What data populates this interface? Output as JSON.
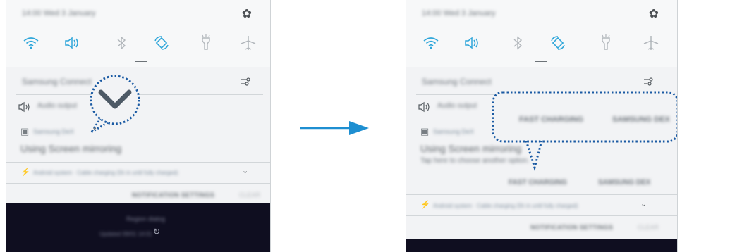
{
  "left_panel": {
    "status": "14:00  Wed 3 January",
    "tiles": [
      "wifi-icon",
      "sound-icon",
      "bluetooth-icon",
      "auto-rotate-icon",
      "flashlight-icon",
      "airplane-mode-icon"
    ],
    "connect": "Samsung Connect",
    "audio": "Audio output",
    "app": "Samsung DeX",
    "title": "Using Screen mirroring",
    "system": "Android system · Cable charging (5h in until fully charged)",
    "notification_settings": "NOTIFICATION SETTINGS",
    "clear": "CLEAR",
    "dark_line1": "Region dialog",
    "dark_line2": "Updated 09/01 14:01"
  },
  "right_panel": {
    "status": "14:00  Wed 3 January",
    "connect": "Samsung Connect",
    "audio": "Audio output",
    "app": "Samsung DeX",
    "title": "Using Screen mirroring",
    "subtitle": "Tap here to choose another option.",
    "callout_buttons": [
      "FAST CHARGING",
      "SAMSUNG DEX"
    ],
    "action_buttons": [
      "FAST CHARGING",
      "SAMSUNG DEX"
    ],
    "system": "Android system · Cable charging (5h in until fully charged)",
    "notification_settings": "NOTIFICATION SETTINGS",
    "clear": "CLEAR"
  },
  "colors": {
    "accent": "#1a5aa3",
    "tile_on": "#2ea6da",
    "dark_bar": "#0f0e20"
  }
}
